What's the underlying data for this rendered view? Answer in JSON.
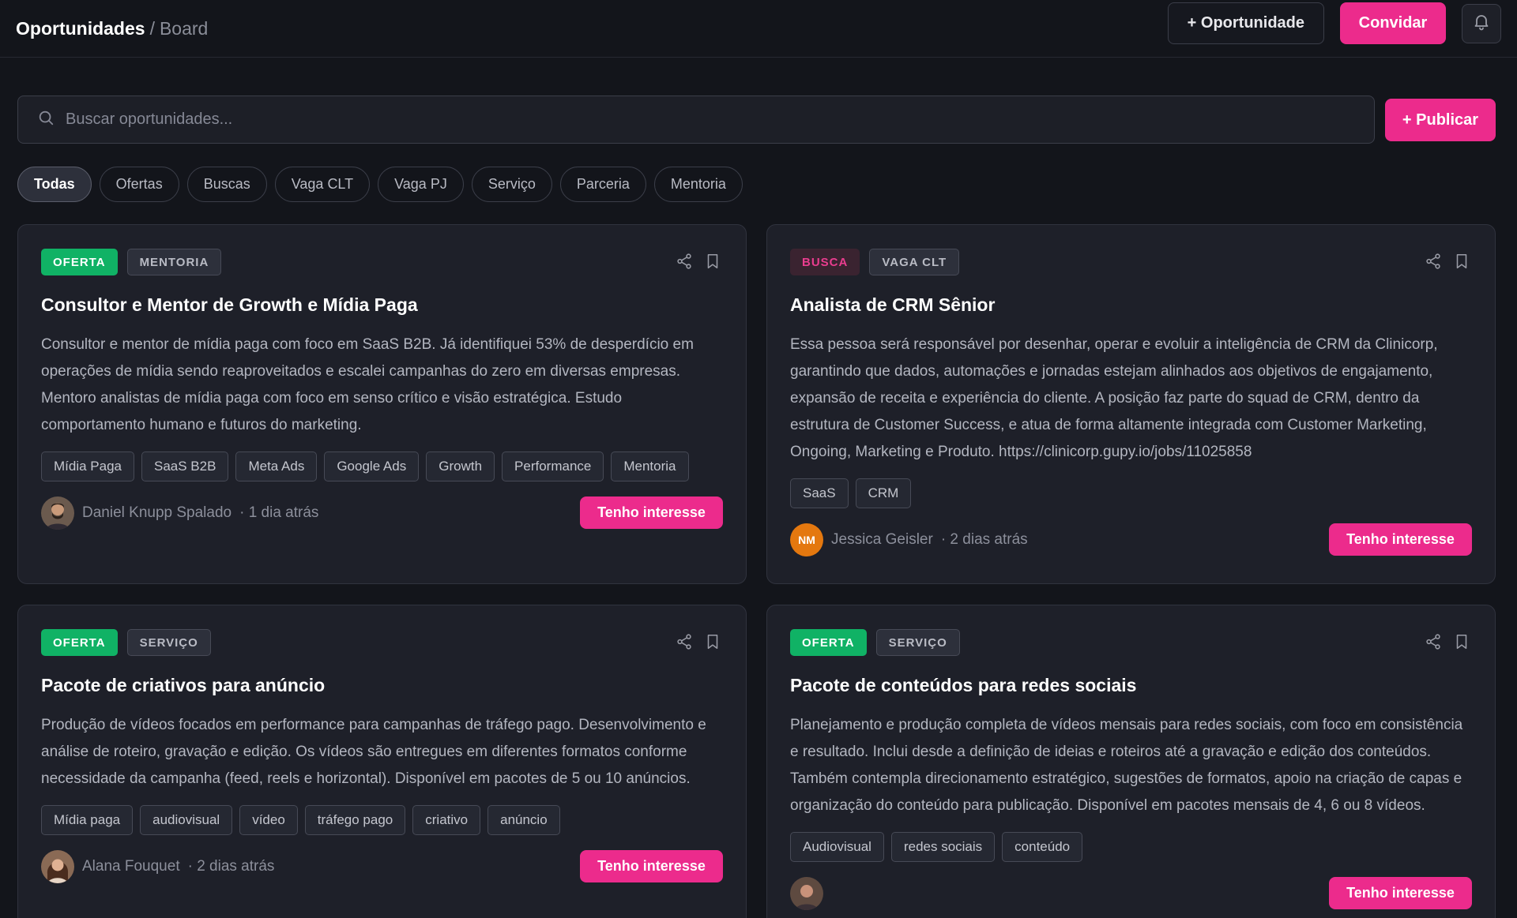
{
  "header": {
    "title": "Oportunidades",
    "separator": "/",
    "subtitle": "Board",
    "new_opportunity_label": "+ Oportunidade",
    "invite_label": "Convidar"
  },
  "search": {
    "placeholder": "Buscar oportunidades...",
    "publish_label": "+ Publicar"
  },
  "filters": [
    "Todas",
    "Ofertas",
    "Buscas",
    "Vaga CLT",
    "Vaga PJ",
    "Serviço",
    "Parceria",
    "Mentoria"
  ],
  "active_filter": "Todas",
  "interest_label": "Tenho interesse",
  "colors": {
    "accent": "#ec2b8c",
    "offer_badge": "#10b265",
    "search_badge": "#ea3d8f",
    "background": "#13151b",
    "card": "#1e2029"
  },
  "cards": [
    {
      "badges": [
        "OFERTA",
        "MENTORIA"
      ],
      "title": "Consultor e Mentor de Growth e Mídia Paga",
      "description": "Consultor e mentor de mídia paga com foco em SaaS B2B. Já identifiquei 53% de desperdício em operações de mídia sendo reaproveitados e escalei campanhas do zero em diversas empresas. Mentoro analistas de mídia paga com foco em senso crítico e visão estratégica. Estudo comportamento humano e futuros do marketing.",
      "tags": [
        "Mídia Paga",
        "SaaS B2B",
        "Meta Ads",
        "Google Ads",
        "Growth",
        "Performance",
        "Mentoria"
      ],
      "author": "Daniel Knupp Spalado",
      "time": "· 1 dia atrás"
    },
    {
      "badges": [
        "BUSCA",
        "VAGA CLT"
      ],
      "title": "Analista de CRM Sênior",
      "description": "Essa pessoa será responsável por desenhar, operar e evoluir a inteligência de CRM da Clinicorp, garantindo que dados, automações e jornadas estejam alinhados aos objetivos de engajamento, expansão de receita e experiência do cliente. A posição faz parte do squad de CRM, dentro da estrutura de Customer Success, e atua de forma altamente integrada com Customer Marketing, Ongoing, Marketing e Produto. https://clinicorp.gupy.io/jobs/11025858",
      "tags": [
        "SaaS",
        "CRM"
      ],
      "author": "Jessica Geisler",
      "author_initials": "NM",
      "time": "· 2 dias atrás"
    },
    {
      "badges": [
        "OFERTA",
        "SERVIÇO"
      ],
      "title": "Pacote de criativos para anúncio",
      "description": "Produção de vídeos focados em performance para campanhas de tráfego pago. Desenvolvimento e análise de roteiro, gravação e edição. Os vídeos são entregues em diferentes formatos conforme necessidade da campanha (feed, reels e horizontal). Disponível em pacotes de 5 ou 10 anúncios.",
      "tags": [
        "Mídia paga",
        "audiovisual",
        "vídeo",
        "tráfego pago",
        "criativo",
        "anúncio"
      ],
      "author": "Alana Fouquet",
      "time": "· 2 dias atrás"
    },
    {
      "badges": [
        "OFERTA",
        "SERVIÇO"
      ],
      "title": "Pacote de conteúdos para redes sociais",
      "description": "Planejamento e produção completa de vídeos mensais para redes sociais, com foco em consistência e resultado. Inclui desde a definição de ideias e roteiros até a gravação e edição dos conteúdos. Também contempla direcionamento estratégico, sugestões de formatos, apoio na criação de capas e organização do conteúdo para publicação. Disponível em pacotes mensais de 4, 6 ou 8 vídeos.",
      "tags": [
        "Audiovisual",
        "redes sociais",
        "conteúdo"
      ]
    }
  ]
}
